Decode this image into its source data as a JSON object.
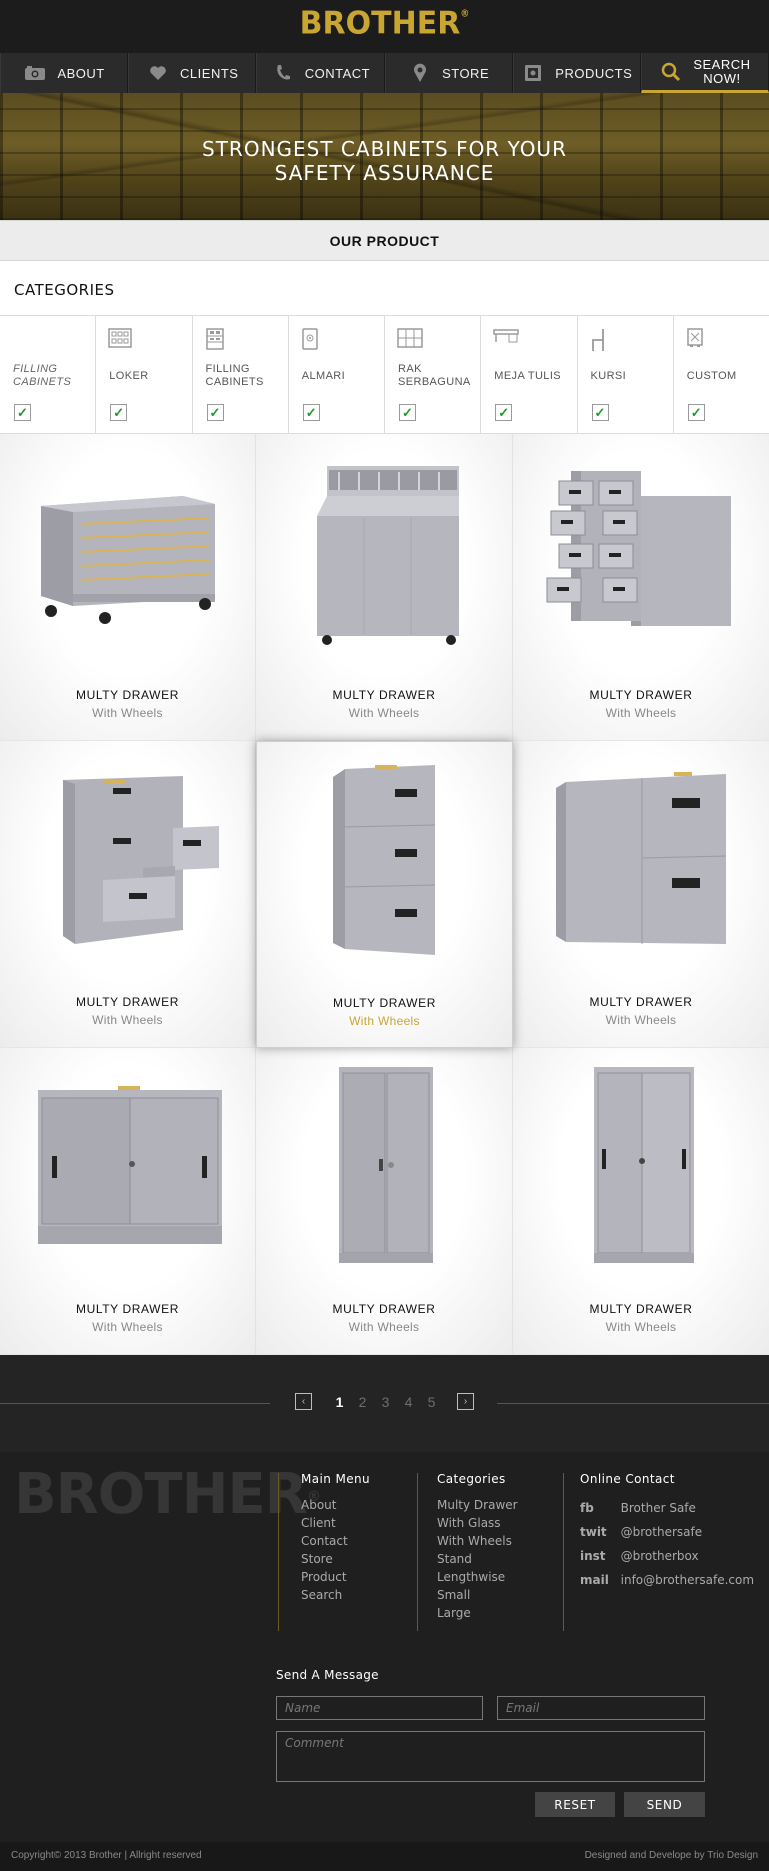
{
  "brand": {
    "logo_text": "BROTHER",
    "registered": "®",
    "accent": "#c9a531"
  },
  "nav": {
    "items": [
      {
        "label": "ABOUT",
        "icon": "camera-icon"
      },
      {
        "label": "CLIENTS",
        "icon": "heart-icon"
      },
      {
        "label": "CONTACT",
        "icon": "phone-icon"
      },
      {
        "label": "STORE",
        "icon": "location-pin-icon"
      },
      {
        "label": "PRODUCTS",
        "icon": "safe-icon"
      }
    ],
    "search_line1": "SEARCH",
    "search_line2": "NOW!"
  },
  "hero": {
    "line1": "STRONGEST CABINETS FOR YOUR",
    "line2": "SAFETY ASSURANCE"
  },
  "section_title": "OUR PRODUCT",
  "categories": {
    "title": "CATEGORIES",
    "items": [
      {
        "label": "FILLING CABINETS",
        "icon": "",
        "checked": true
      },
      {
        "label": "LOKER",
        "icon": "locker-icon",
        "checked": true
      },
      {
        "label": "FILLING CABINETS",
        "icon": "filing-cabinet-icon",
        "checked": true
      },
      {
        "label": "ALMARI",
        "icon": "almari-icon",
        "checked": true
      },
      {
        "label": "RAK SERBAGUNA",
        "icon": "shelf-icon",
        "checked": true
      },
      {
        "label": "MEJA TULIS",
        "icon": "desk-icon",
        "checked": true
      },
      {
        "label": "KURSI",
        "icon": "chair-icon",
        "checked": true
      },
      {
        "label": "CUSTOM",
        "icon": "custom-icon",
        "checked": true
      }
    ]
  },
  "products": [
    {
      "name": "MULTY DRAWER",
      "sub": "With Wheels",
      "kind": "plan-drawer"
    },
    {
      "name": "MULTY DRAWER",
      "sub": "With Wheels",
      "kind": "hanging-box"
    },
    {
      "name": "MULTY DRAWER",
      "sub": "With Wheels",
      "kind": "multi-drawer"
    },
    {
      "name": "MULTY DRAWER",
      "sub": "With Wheels",
      "kind": "open-drawers"
    },
    {
      "name": "MULTY DRAWER",
      "sub": "With Wheels",
      "kind": "three-drawer"
    },
    {
      "name": "MULTY DRAWER",
      "sub": "With Wheels",
      "kind": "two-drawer"
    },
    {
      "name": "MULTY DRAWER",
      "sub": "With Wheels",
      "kind": "sliding-low"
    },
    {
      "name": "MULTY DRAWER",
      "sub": "With Wheels",
      "kind": "swing-tall"
    },
    {
      "name": "MULTY DRAWER",
      "sub": "With Wheels",
      "kind": "sliding-tall"
    }
  ],
  "pagination": {
    "pages": [
      "1",
      "2",
      "3",
      "4",
      "5"
    ],
    "current": "1",
    "prev": "‹",
    "next": "›"
  },
  "footer": {
    "logo_text": "BROTHER",
    "registered": "®",
    "main_menu": {
      "title": "Main Menu",
      "items": [
        "About",
        "Client",
        "Contact",
        "Store",
        "Product",
        "Search"
      ]
    },
    "categories": {
      "title": "Categories",
      "items": [
        "Multy Drawer",
        "With Glass",
        "With Wheels",
        "Stand",
        "Lengthwise",
        "Small",
        "Large"
      ]
    },
    "online_contact": {
      "title": "Online Contact",
      "items": [
        {
          "key": "fb",
          "value": "Brother Safe"
        },
        {
          "key": "twit",
          "value": "@brothersafe"
        },
        {
          "key": "inst",
          "value": "@brotherbox"
        },
        {
          "key": "mail",
          "value": "info@brothersafe.com"
        }
      ]
    },
    "message": {
      "title": "Send A Message",
      "name_placeholder": "Name",
      "email_placeholder": "Email",
      "comment_placeholder": "Comment",
      "reset_label": "RESET",
      "send_label": "SEND"
    },
    "copyright": "Copyright© 2013 Brother | Allright reserved",
    "credit": "Designed and Develope by Trio Design"
  }
}
